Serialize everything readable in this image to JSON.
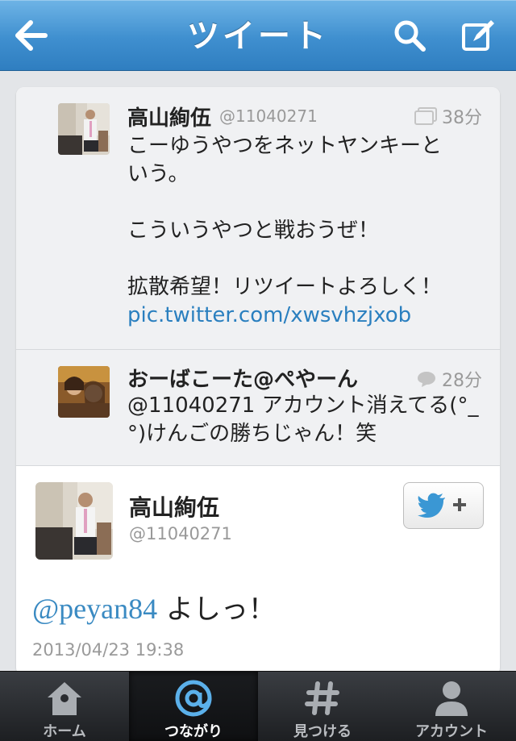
{
  "header": {
    "title": "ツイート",
    "back_icon": "arrow-left-icon",
    "search_icon": "search-icon",
    "compose_icon": "compose-icon"
  },
  "conversation": [
    {
      "name": "高山絢伍",
      "handle": "@11040271",
      "time": "38分",
      "time_icon": "image-icon",
      "lines": [
        "こーゆうやつをネットヤンキーと",
        "いう。",
        "",
        "こういうやつと戦おうぜ！",
        "",
        "拡散希望！リツイートよろしく！"
      ],
      "link": "pic.twitter.com/xwsvhzjxob"
    },
    {
      "name": "おーばこーた@ぺやーん",
      "time": "28分",
      "time_icon": "reply-bubble-icon",
      "lines": [
        "@11040271 アカウント消えてる(°_",
        "°)けんごの勝ちじゃん！笑"
      ]
    }
  ],
  "main_tweet": {
    "name": "高山絢伍",
    "handle": "@11040271",
    "mention": "@peyan84",
    "text": " よしっ！",
    "date": "2013/04/23 19:38",
    "follow_icon": "twitter-bird-plus-icon"
  },
  "tabs": [
    {
      "label": "ホーム",
      "icon": "home-icon",
      "active": false
    },
    {
      "label": "つながり",
      "icon": "at-icon",
      "active": true
    },
    {
      "label": "見つける",
      "icon": "hash-icon",
      "active": false
    },
    {
      "label": "アカウント",
      "icon": "person-icon",
      "active": false
    }
  ],
  "colors": {
    "nav_blue": "#3f8fcf",
    "link_blue": "#2a7fbf",
    "tab_dark": "#1d1f22"
  }
}
